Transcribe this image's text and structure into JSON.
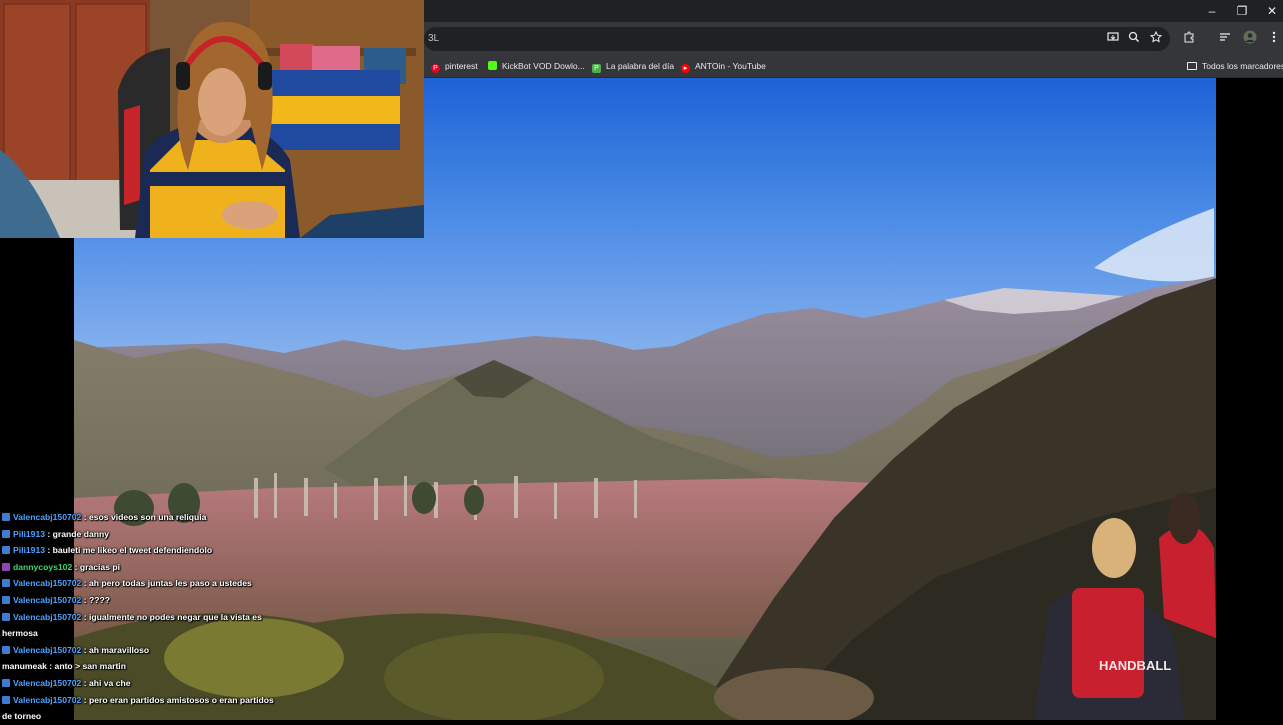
{
  "browser": {
    "url_fragment": "3L",
    "window_controls": [
      "–",
      "❐",
      "✕"
    ],
    "toolbar_icons": [
      "install-icon",
      "zoom-icon",
      "star-icon",
      "extensions-icon",
      "tab-search-icon",
      "profile-icon",
      "menu-icon"
    ],
    "bookmarks": [
      {
        "label": "pinterest",
        "icon": "pinterest-icon",
        "color": "#e60023"
      },
      {
        "label": "KickBot VOD Dowlo...",
        "icon": "kickbot-icon",
        "color": "#53fc18"
      },
      {
        "label": "La palabra del día",
        "icon": "palabra-icon",
        "color": "#4caf50"
      },
      {
        "label": "ANTOin - YouTube",
        "icon": "youtube-icon",
        "color": "#ff0000"
      }
    ],
    "all_bookmarks_label": "Todos los marcadores"
  },
  "webcam": {
    "jersey_text": "HANDBALL"
  },
  "chat": {
    "messages": [
      {
        "user": "Valencabj150702",
        "text": ": esos videos son una reliquia",
        "style": "blue"
      },
      {
        "user": "Pili1913",
        "text": ": grande danny",
        "style": "white"
      },
      {
        "user": "Pili1913",
        "text": ": bauleti me likeo el tweet defendiendolo",
        "style": "white"
      },
      {
        "user": "dannycoys102",
        "text": ": gracias pi",
        "style": "green"
      },
      {
        "user": "Valencabj150702",
        "text": ": ah pero todas juntas les paso a ustedes",
        "style": "blue"
      },
      {
        "user": "Valencabj150702",
        "text": ": ????",
        "style": "blue"
      },
      {
        "user": "Valencabj150702",
        "text": ": igualmente no podes negar que la vista es",
        "style": "blue",
        "cont": "hermosa"
      },
      {
        "user": "Valencabj150702",
        "text": ": ah maravilloso",
        "style": "blue"
      },
      {
        "user": "manumeak",
        "text": ": anto > san martin",
        "style": "white",
        "nobadge": true
      },
      {
        "user": "Valencabj150702",
        "text": ": ahi va che",
        "style": "blue"
      },
      {
        "user": "Valencabj150702",
        "text": ": pero eran partidos amistosos o eran partidos",
        "style": "blue",
        "cont": "de torneo"
      }
    ]
  }
}
